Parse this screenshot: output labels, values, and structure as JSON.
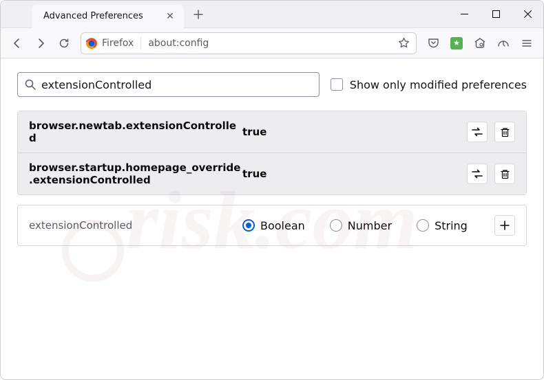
{
  "tab": {
    "title": "Advanced Preferences"
  },
  "urlbar": {
    "prefix": "Firefox",
    "address": "about:config"
  },
  "search": {
    "value": "extensionControlled",
    "checkbox_label": "Show only modified preferences"
  },
  "prefs": [
    {
      "name": "browser.newtab.extensionControlled",
      "value": "true"
    },
    {
      "name": "browser.startup.homepage_override.extensionControlled",
      "value": "true"
    }
  ],
  "new_pref": {
    "name": "extensionControlled",
    "types": [
      {
        "label": "Boolean",
        "selected": true
      },
      {
        "label": "Number",
        "selected": false
      },
      {
        "label": "String",
        "selected": false
      }
    ]
  },
  "watermark": "risk.com"
}
